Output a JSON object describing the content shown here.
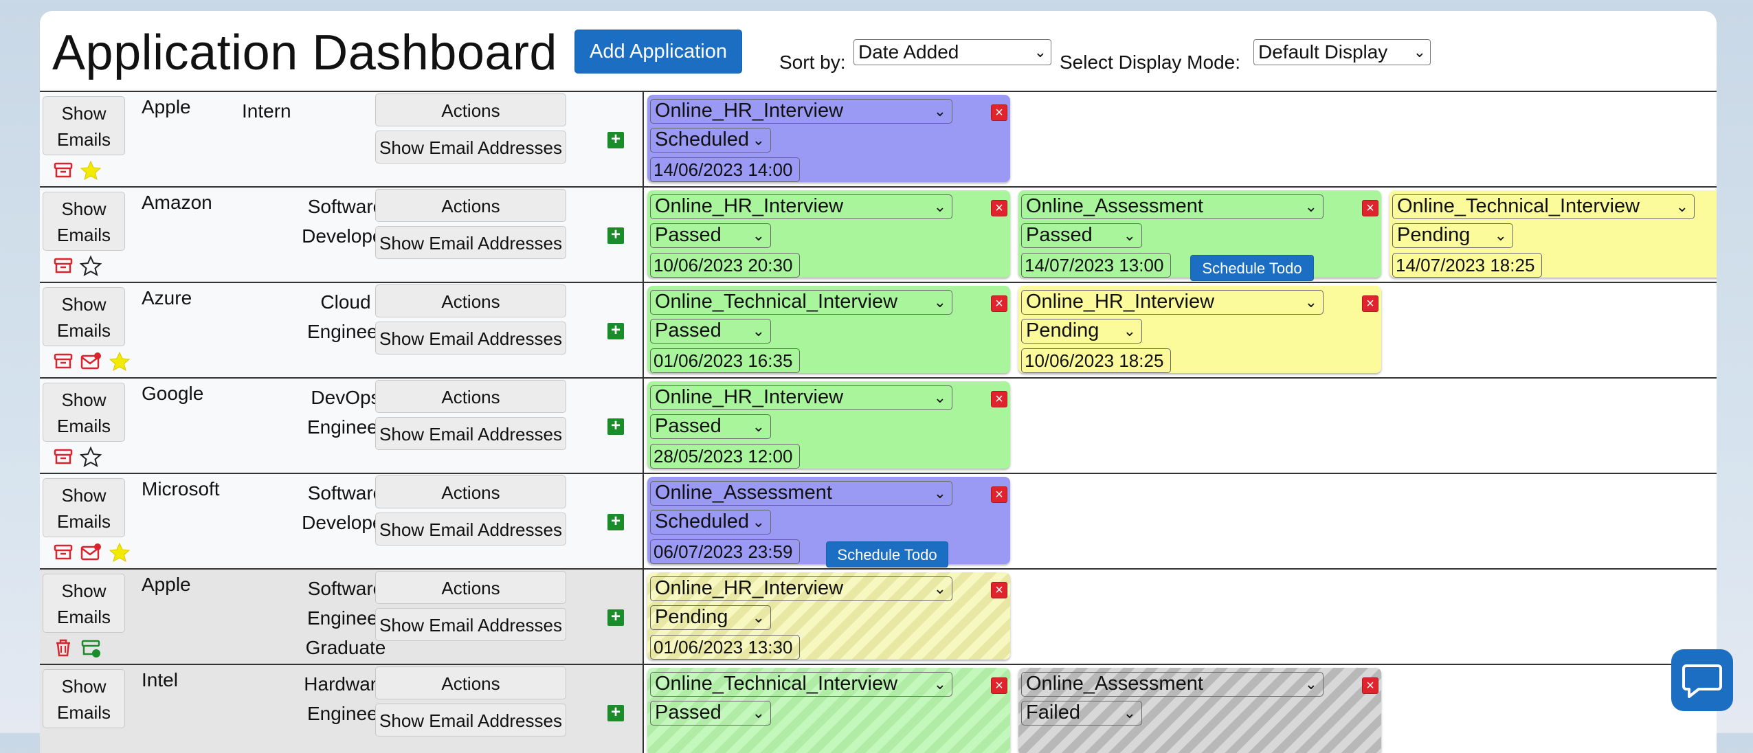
{
  "header": {
    "title": "Application Dashboard",
    "add_button": "Add Application",
    "sort_label": "Sort by:",
    "sort_value": "Date Added",
    "display_label": "Select Display Mode:",
    "display_value": "Default Display"
  },
  "common": {
    "show_emails": "Show Emails",
    "actions": "Actions",
    "show_addresses": "Show Email Addresses",
    "schedule_todo": "Schedule Todo"
  },
  "rows": [
    {
      "company": "Apple",
      "role": "Intern",
      "stages": [
        {
          "type": "Online_HR_Interview",
          "status": "Scheduled",
          "date": "14/06/2023 14:00"
        }
      ]
    },
    {
      "company": "Amazon",
      "role": "Software Developer",
      "stages": [
        {
          "type": "Online_HR_Interview",
          "status": "Passed",
          "date": "10/06/2023 20:30"
        },
        {
          "type": "Online_Assessment",
          "status": "Passed",
          "date": "14/07/2023 13:00"
        },
        {
          "type": "Online_Technical_Interview",
          "status": "Pending",
          "date": "14/07/2023 18:25"
        }
      ]
    },
    {
      "company": "Azure",
      "role": "Cloud Engineer",
      "stages": [
        {
          "type": "Online_Technical_Interview",
          "status": "Passed",
          "date": "01/06/2023 16:35"
        },
        {
          "type": "Online_HR_Interview",
          "status": "Pending",
          "date": "10/06/2023 18:25"
        }
      ]
    },
    {
      "company": "Google",
      "role": "DevOps Engineer",
      "stages": [
        {
          "type": "Online_HR_Interview",
          "status": "Passed",
          "date": "28/05/2023 12:00"
        }
      ]
    },
    {
      "company": "Microsoft",
      "role": "Software Developer",
      "stages": [
        {
          "type": "Online_Assessment",
          "status": "Scheduled",
          "date": "06/07/2023 23:59"
        }
      ]
    },
    {
      "company": "Apple",
      "role": "Software Engineer Graduate",
      "stages": [
        {
          "type": "Online_HR_Interview",
          "status": "Pending",
          "date": "01/06/2023 13:30"
        }
      ]
    },
    {
      "company": "Intel",
      "role": "Hardware Engineer",
      "stages": [
        {
          "type": "Online_Technical_Interview",
          "status": "Passed",
          "date": ""
        },
        {
          "type": "Online_Assessment",
          "status": "Failed",
          "date": ""
        }
      ]
    }
  ]
}
